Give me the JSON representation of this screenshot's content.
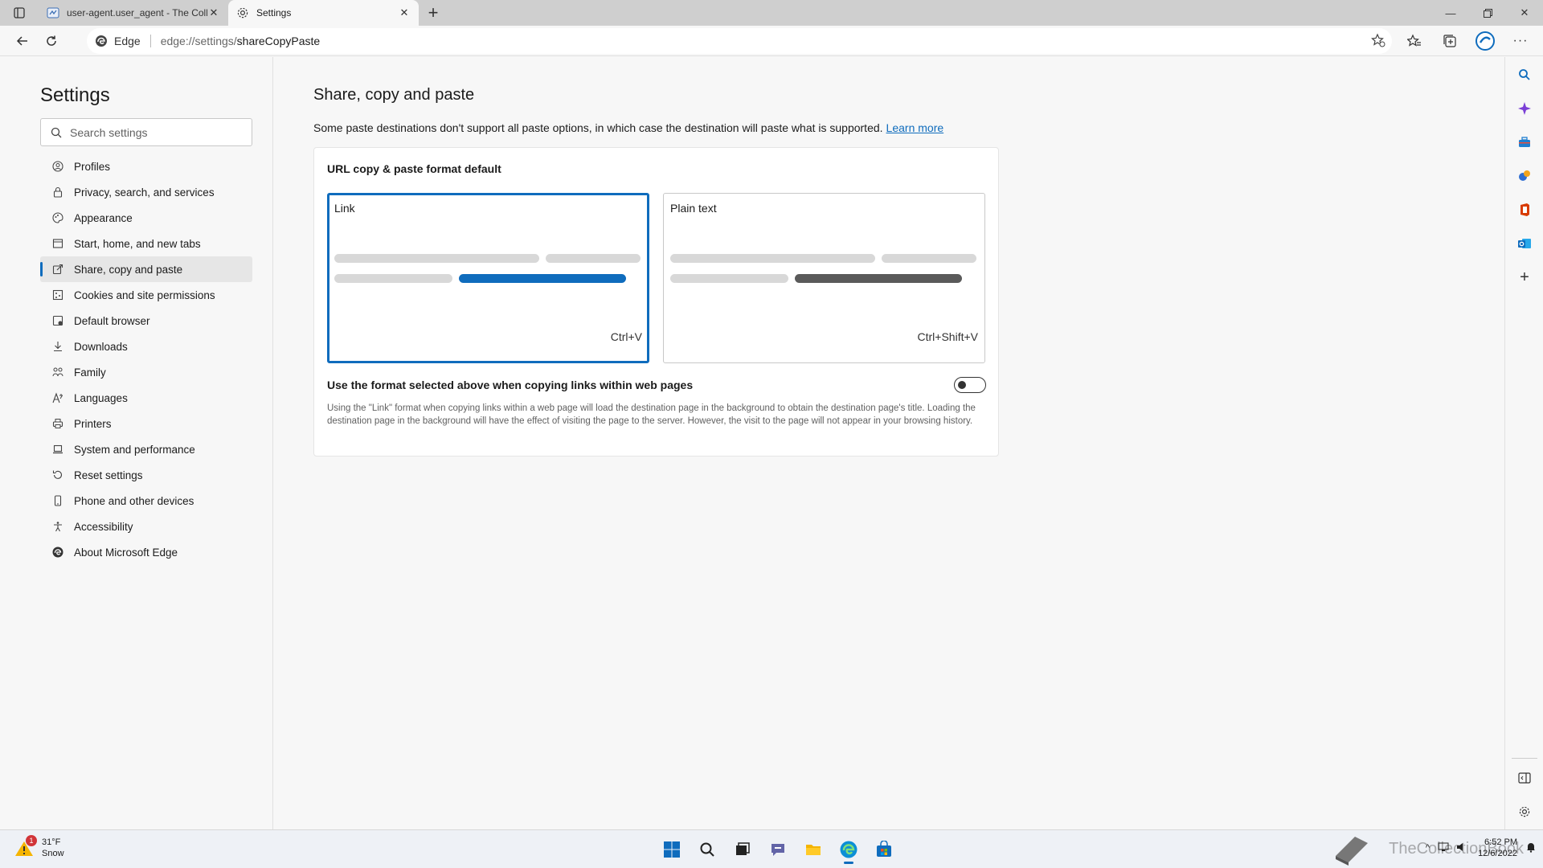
{
  "browser": {
    "tabs": [
      {
        "title": "user-agent.user_agent - The Coll",
        "active": false
      },
      {
        "title": "Settings",
        "active": true
      }
    ],
    "address": {
      "site_label": "Edge",
      "url_prefix": "edge://settings/",
      "url_path": "shareCopyPaste"
    }
  },
  "sidebar": {
    "title": "Settings",
    "search_placeholder": "Search settings",
    "items": [
      {
        "label": "Profiles",
        "icon": "profile-icon"
      },
      {
        "label": "Privacy, search, and services",
        "icon": "lock-icon"
      },
      {
        "label": "Appearance",
        "icon": "palette-icon"
      },
      {
        "label": "Start, home, and new tabs",
        "icon": "home-tabs-icon"
      },
      {
        "label": "Share, copy and paste",
        "icon": "share-icon",
        "selected": true
      },
      {
        "label": "Cookies and site permissions",
        "icon": "cookies-icon"
      },
      {
        "label": "Default browser",
        "icon": "browser-icon"
      },
      {
        "label": "Downloads",
        "icon": "download-icon"
      },
      {
        "label": "Family",
        "icon": "family-icon"
      },
      {
        "label": "Languages",
        "icon": "language-icon"
      },
      {
        "label": "Printers",
        "icon": "printer-icon"
      },
      {
        "label": "System and performance",
        "icon": "laptop-icon"
      },
      {
        "label": "Reset settings",
        "icon": "reset-icon"
      },
      {
        "label": "Phone and other devices",
        "icon": "phone-icon"
      },
      {
        "label": "Accessibility",
        "icon": "accessibility-icon"
      },
      {
        "label": "About Microsoft Edge",
        "icon": "edge-logo-icon"
      }
    ]
  },
  "main": {
    "title": "Share, copy and paste",
    "description": "Some paste destinations don't support all paste options, in which case the destination will paste what is supported.",
    "learn_more": "Learn more",
    "card": {
      "title": "URL copy & paste format default",
      "options": [
        {
          "label": "Link",
          "shortcut": "Ctrl+V",
          "selected": true
        },
        {
          "label": "Plain text",
          "shortcut": "Ctrl+Shift+V",
          "selected": false
        }
      ],
      "toggle_label": "Use the format selected above when copying links within web pages",
      "toggle_on": false,
      "help_text": "Using the \"Link\" format when copying links within a web page will load the destination page in the background to obtain the destination page's title. Loading the destination page in the background will have the effect of visiting the page to the server. However, the visit to the page will not appear in your browsing history."
    }
  },
  "taskbar": {
    "weather_temp": "31°F",
    "weather_cond": "Snow",
    "weather_badge": "1",
    "time": "6:52 PM",
    "date": "12/6/2022",
    "watermark": "TheCollectionBook"
  },
  "colors": {
    "accent": "#0f6cbd",
    "selected_bar": "#0f6cbd",
    "plain_bar": "#5a5a5a"
  }
}
